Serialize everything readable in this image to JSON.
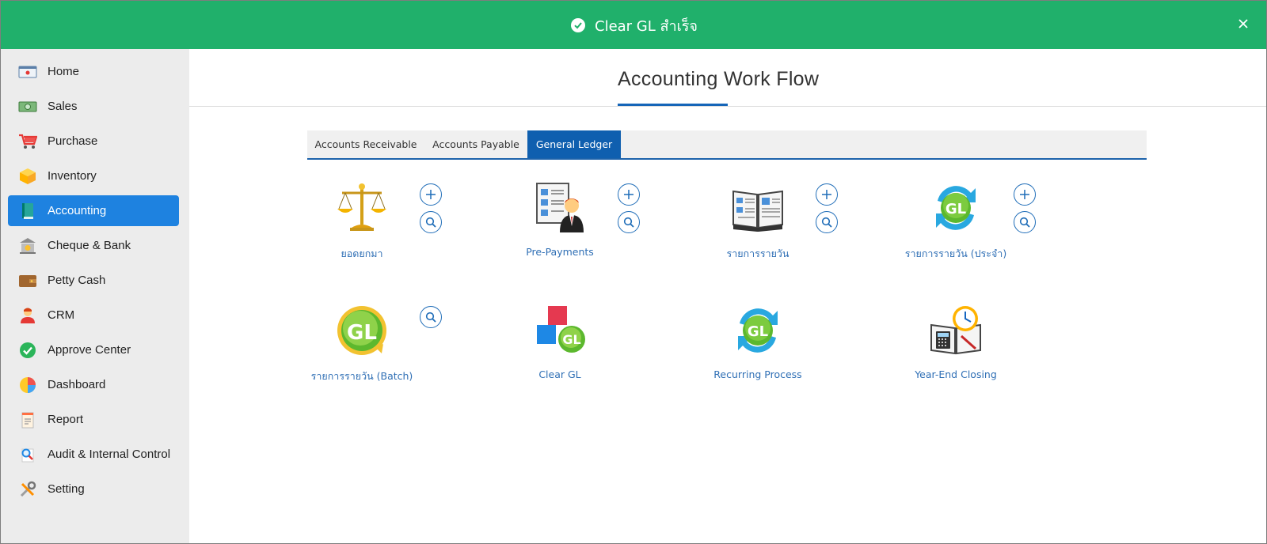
{
  "toast": {
    "message": "Clear GL สำเร็จ",
    "color": "#20b06b"
  },
  "sidebar": {
    "items": [
      {
        "label": "Home",
        "icon": "home-icon"
      },
      {
        "label": "Sales",
        "icon": "money-icon"
      },
      {
        "label": "Purchase",
        "icon": "cart-icon"
      },
      {
        "label": "Inventory",
        "icon": "box-icon"
      },
      {
        "label": "Accounting",
        "icon": "book-icon",
        "active": true
      },
      {
        "label": "Cheque & Bank",
        "icon": "bank-icon"
      },
      {
        "label": "Petty Cash",
        "icon": "wallet-icon"
      },
      {
        "label": "CRM",
        "icon": "people-icon"
      },
      {
        "label": "Approve Center",
        "icon": "check-icon"
      },
      {
        "label": "Dashboard",
        "icon": "piechart-icon"
      },
      {
        "label": "Report",
        "icon": "report-icon"
      },
      {
        "label": "Audit & Internal Control",
        "icon": "magnifier-icon"
      },
      {
        "label": "Setting",
        "icon": "tools-icon"
      }
    ],
    "active_color": "#1e82e0"
  },
  "main": {
    "title": "Accounting Work Flow",
    "tabs": [
      {
        "label": "Accounts Receivable"
      },
      {
        "label": "Accounts Payable"
      },
      {
        "label": "General Ledger",
        "active": true
      }
    ],
    "tiles": [
      {
        "label": "ยอดยกมา",
        "icon": "scale-icon"
      },
      {
        "label": "Pre-Payments",
        "icon": "businessman-book-icon"
      },
      {
        "label": "รายการรายวัน",
        "icon": "journal-book-icon"
      },
      {
        "label": "รายการรายวัน (ประจำ)",
        "icon": "gl-recurring-icon"
      },
      {
        "label": "รายการรายวัน (Batch)",
        "icon": "gl-batch-icon"
      },
      {
        "label": "Clear GL",
        "icon": "clear-gl-icon"
      },
      {
        "label": "Recurring Process",
        "icon": "recurring-gl-icon"
      },
      {
        "label": "Year-End Closing",
        "icon": "year-end-icon"
      }
    ]
  }
}
